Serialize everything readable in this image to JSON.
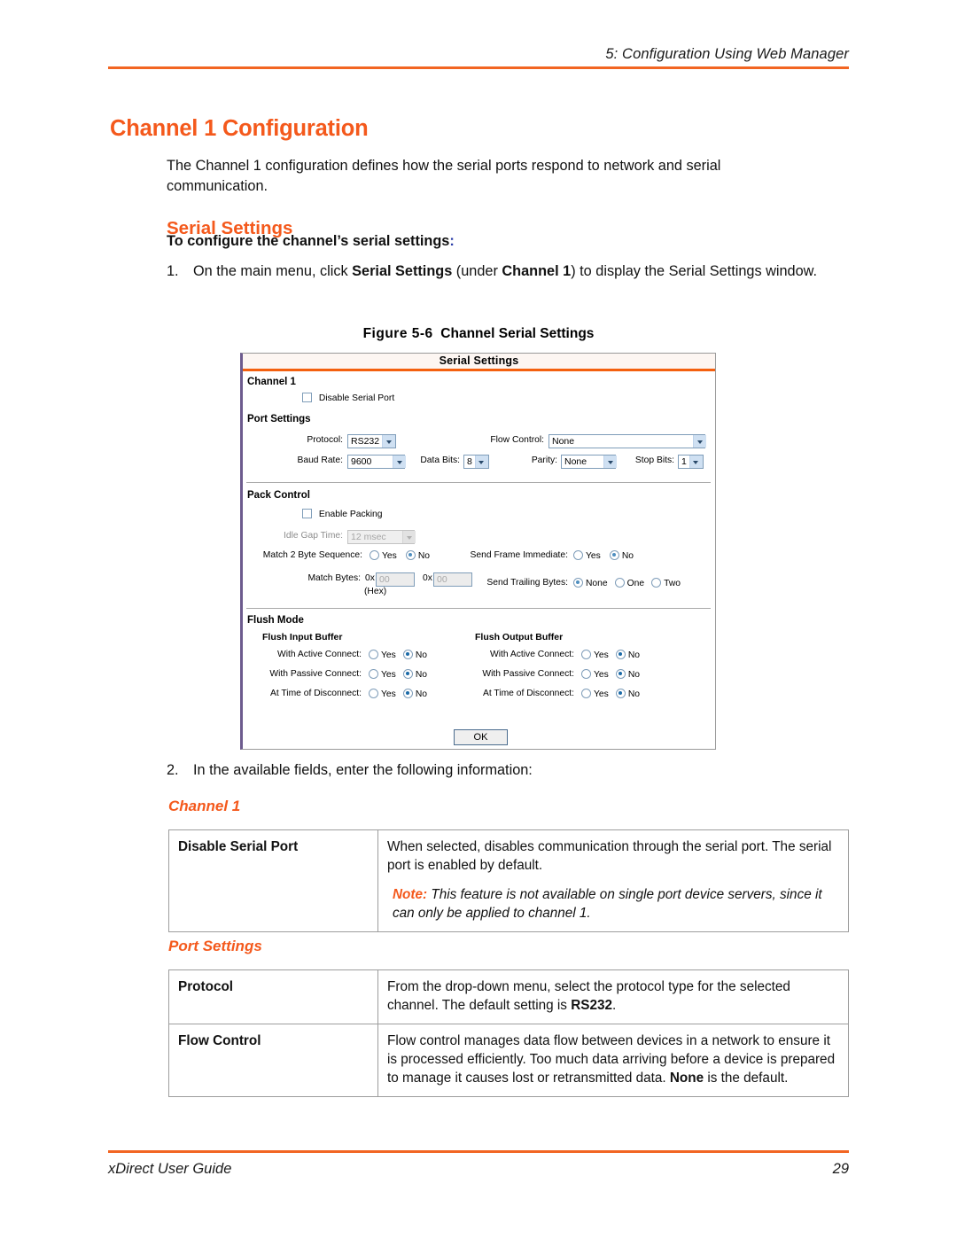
{
  "page": {
    "running_head": "5: Configuration Using Web Manager",
    "title": "Channel 1 Configuration",
    "intro": "The Channel 1 configuration defines how the serial ports respond to network and serial communication.",
    "section_heading": "Serial Settings",
    "task_heading": "To configure the channel’s serial settings",
    "task_heading_colon": ":",
    "accent_color": "#F4591C",
    "rule_color": "#F26522"
  },
  "steps": [
    {
      "num": "1.",
      "text": "On the main menu, click Serial Settings (under Channel 1) to display the Serial Settings window.",
      "parts": [
        {
          "t": "On the main menu, click ",
          "b": false
        },
        {
          "t": "Serial Settings",
          "b": true
        },
        {
          "t": " (under ",
          "b": false
        },
        {
          "t": "Channel 1",
          "b": true
        },
        {
          "t": ") to display the Serial Settings window.",
          "b": false
        }
      ]
    },
    {
      "num": "2.",
      "text": "In the available fields, enter the following information:"
    }
  ],
  "figure": {
    "caption_label": "Figure 5-6",
    "caption_text": "Channel Serial Settings",
    "window": {
      "title": "Serial Settings",
      "channel_group": "Channel 1",
      "disable_serial_port": {
        "label": "Disable Serial Port",
        "checked": false
      },
      "port_settings": {
        "heading": "Port Settings",
        "protocol": {
          "label": "Protocol:",
          "value": "RS232"
        },
        "flow_control": {
          "label": "Flow Control:",
          "value": "None"
        },
        "baud_rate": {
          "label": "Baud Rate:",
          "value": "9600"
        },
        "data_bits": {
          "label": "Data Bits:",
          "value": "8"
        },
        "parity": {
          "label": "Parity:",
          "value": "None"
        },
        "stop_bits": {
          "label": "Stop Bits:",
          "value": "1"
        }
      },
      "pack_control": {
        "heading": "Pack Control",
        "enable_packing": {
          "label": "Enable Packing",
          "checked": false
        },
        "idle_gap_time": {
          "label": "Idle Gap Time:",
          "value": "12 msec",
          "disabled": true
        },
        "match_2_byte_sequence": {
          "label": "Match 2 Byte Sequence:",
          "options": [
            "Yes",
            "No"
          ],
          "selected": "No"
        },
        "send_frame_immediate": {
          "label": "Send Frame Immediate:",
          "options": [
            "Yes",
            "No"
          ],
          "selected": "No"
        },
        "match_bytes": {
          "label": "Match Bytes:",
          "hex_note": "(Hex)",
          "prefix": "0x",
          "value1": "00",
          "value2": "00"
        },
        "send_trailing_bytes": {
          "label": "Send Trailing Bytes:",
          "options": [
            "None",
            "One",
            "Two"
          ],
          "selected": "None"
        }
      },
      "flush_mode": {
        "heading": "Flush Mode",
        "input_buffer": {
          "heading": "Flush Input Buffer",
          "rows": [
            {
              "label": "With Active Connect:",
              "options": [
                "Yes",
                "No"
              ],
              "selected": "No"
            },
            {
              "label": "With Passive Connect:",
              "options": [
                "Yes",
                "No"
              ],
              "selected": "No"
            },
            {
              "label": "At Time of Disconnect:",
              "options": [
                "Yes",
                "No"
              ],
              "selected": "No"
            }
          ]
        },
        "output_buffer": {
          "heading": "Flush Output Buffer",
          "rows": [
            {
              "label": "With Active Connect:",
              "options": [
                "Yes",
                "No"
              ],
              "selected": "No"
            },
            {
              "label": "With Passive Connect:",
              "options": [
                "Yes",
                "No"
              ],
              "selected": "No"
            },
            {
              "label": "At Time of Disconnect:",
              "options": [
                "Yes",
                "No"
              ],
              "selected": "No"
            }
          ]
        }
      },
      "ok_button": "OK"
    }
  },
  "tables": [
    {
      "group_title": "Channel 1",
      "rows": [
        {
          "key": "Disable Serial Port",
          "desc": "When selected, disables communication through the serial port. The serial port is enabled by default.",
          "note_label": "Note:",
          "note_text": "This feature is not available on single port device servers, since it can only be applied to channel 1."
        }
      ]
    },
    {
      "group_title": "Port Settings",
      "rows": [
        {
          "key": "Protocol",
          "desc_parts": [
            {
              "t": "From the drop-down menu, select the protocol type for the selected channel. The default setting is ",
              "b": false
            },
            {
              "t": "RS232",
              "b": true
            },
            {
              "t": ".",
              "b": false
            }
          ]
        },
        {
          "key": "Flow Control",
          "desc_parts": [
            {
              "t": "Flow control manages data flow between devices in a network to ensure it is processed efficiently. Too much data arriving before a device is prepared to manage it causes lost or retransmitted data. ",
              "b": false
            },
            {
              "t": "None",
              "b": true
            },
            {
              "t": " is the default.",
              "b": false
            }
          ]
        }
      ]
    }
  ],
  "footer": {
    "guide_title": "xDirect User Guide",
    "page_number": "29"
  }
}
